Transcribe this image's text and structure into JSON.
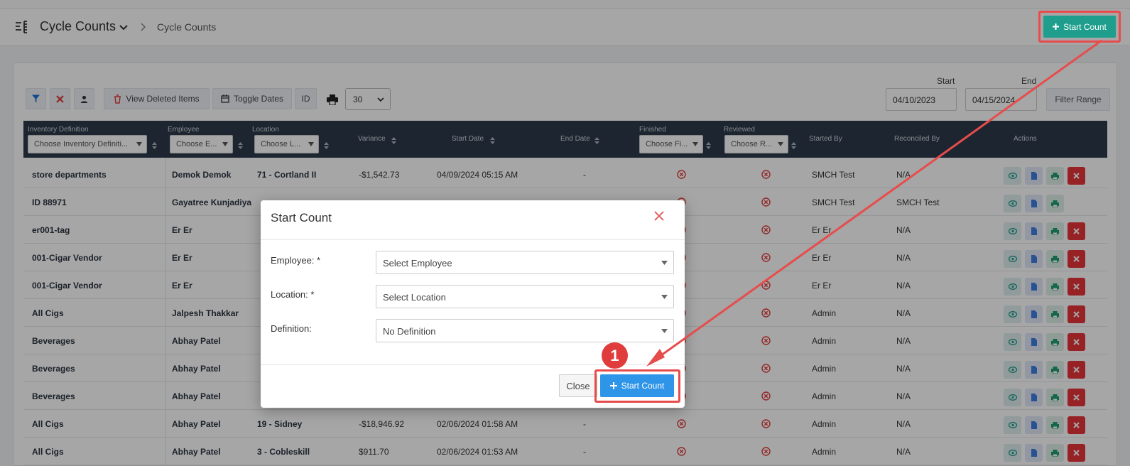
{
  "header": {
    "title": "Cycle Counts",
    "breadcrumb": "Cycle Counts",
    "start_count_label": "Start Count"
  },
  "toolbar": {
    "view_deleted_label": "View Deleted Items",
    "toggle_dates_label": "Toggle Dates",
    "id_label": "ID",
    "page_size": "30",
    "start_label": "Start",
    "end_label": "End",
    "start_date": "04/10/2023",
    "end_date": "04/15/2024",
    "filter_range_label": "Filter Range"
  },
  "table": {
    "columns": {
      "inventory_definition": "Inventory Definition",
      "employee": "Employee",
      "location": "Location",
      "variance": "Variance",
      "start_date": "Start Date",
      "end_date": "End Date",
      "finished": "Finished",
      "reviewed": "Reviewed",
      "started_by": "Started By",
      "reconciled_by": "Reconciled By",
      "actions": "Actions"
    },
    "filters": {
      "inventory_definition": "Choose Inventory Definiti...",
      "employee": "Choose E...",
      "location": "Choose L...",
      "finished": "Choose Fi...",
      "reviewed": "Choose R..."
    },
    "rows": [
      {
        "def": "store departments",
        "employee": "Demok Demok",
        "location": "71 - Cortland II",
        "variance": "-$1,542.73",
        "start": "04/09/2024 05:15 AM",
        "end": "-",
        "started_by": "SMCH Test",
        "reconciled_by": "N/A"
      },
      {
        "def": "ID 88971",
        "employee": "Gayatree Kunjadiya",
        "location": "",
        "variance": "",
        "start": "",
        "end": "",
        "started_by": "SMCH Test",
        "reconciled_by": "SMCH Test"
      },
      {
        "def": "er001-tag",
        "employee": "Er Er",
        "location": "",
        "variance": "",
        "start": "",
        "end": "",
        "started_by": "Er Er",
        "reconciled_by": "N/A"
      },
      {
        "def": "001-Cigar Vendor",
        "employee": "Er Er",
        "location": "",
        "variance": "",
        "start": "",
        "end": "",
        "started_by": "Er Er",
        "reconciled_by": "N/A"
      },
      {
        "def": "001-Cigar Vendor",
        "employee": "Er Er",
        "location": "",
        "variance": "",
        "start": "",
        "end": "",
        "started_by": "Er Er",
        "reconciled_by": "N/A"
      },
      {
        "def": "All Cigs",
        "employee": "Jalpesh Thakkar",
        "location": "",
        "variance": "",
        "start": "",
        "end": "",
        "started_by": "Admin",
        "reconciled_by": "N/A"
      },
      {
        "def": "Beverages",
        "employee": "Abhay Patel",
        "location": "",
        "variance": "",
        "start": "",
        "end": "",
        "started_by": "Admin",
        "reconciled_by": "N/A"
      },
      {
        "def": "Beverages",
        "employee": "Abhay Patel",
        "location": "",
        "variance": "",
        "start": "",
        "end": "",
        "started_by": "Admin",
        "reconciled_by": "N/A"
      },
      {
        "def": "Beverages",
        "employee": "Abhay Patel",
        "location": "",
        "variance": "",
        "start": "",
        "end": "",
        "started_by": "Admin",
        "reconciled_by": "N/A"
      },
      {
        "def": "All Cigs",
        "employee": "Abhay Patel",
        "location": "19 - Sidney",
        "variance": "-$18,946.92",
        "start": "02/06/2024 01:58 AM",
        "end": "-",
        "started_by": "Admin",
        "reconciled_by": "N/A"
      },
      {
        "def": "All Cigs",
        "employee": "Abhay Patel",
        "location": "3 - Cobleskill",
        "variance": "$911.70",
        "start": "02/06/2024 01:53 AM",
        "end": "-",
        "started_by": "Admin",
        "reconciled_by": "N/A"
      }
    ]
  },
  "modal": {
    "title": "Start Count",
    "employee_label": "Employee: *",
    "employee_value": "Select Employee",
    "location_label": "Location: *",
    "location_value": "Select Location",
    "definition_label": "Definition:",
    "definition_value": "No Definition",
    "close_label": "Close",
    "start_label": "Start Count"
  },
  "annotation": {
    "step_number": "1"
  },
  "colors": {
    "primary_teal": "#1f9e8d",
    "modal_primary": "#2e95e8",
    "highlight_red": "#e74c4c",
    "header_dark": "#2c3a4a"
  }
}
